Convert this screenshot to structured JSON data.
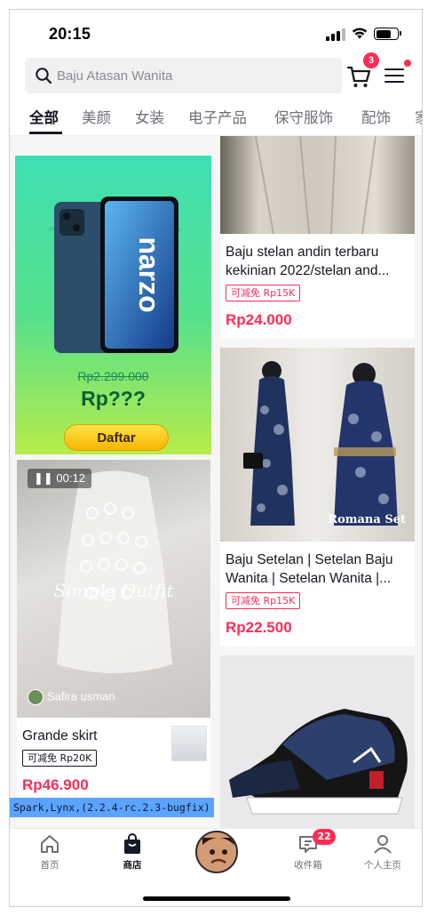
{
  "status_bar": {
    "time": "20:15"
  },
  "header": {
    "search_placeholder": "Baju Atasan Wanita",
    "cart_count": "3",
    "icons": {
      "search": "search-icon",
      "cart": "cart-icon",
      "menu": "menu-icon"
    }
  },
  "tabs": [
    {
      "label": "全部",
      "active": true
    },
    {
      "label": "美颜"
    },
    {
      "label": "女装"
    },
    {
      "label": "电子产品"
    },
    {
      "label": "保守服饰"
    },
    {
      "label": "配饰"
    },
    {
      "label": "家"
    }
  ],
  "feed": {
    "ad": {
      "brand": "narzo",
      "old_price": "Rp2.299.000",
      "price": "Rp???",
      "button": "Daftar"
    },
    "video": {
      "duration": "00:12",
      "overlay_text": "Simple Outfit",
      "author": "Safira usman",
      "title": "Grande skirt",
      "coupon": "可减免 Rp20K",
      "price": "Rp46.900"
    },
    "products": [
      {
        "title_line1": "Baju stelan andin terbaru",
        "title_line2": "kekinian 2022/stelan and...",
        "coupon": "可减免 Rp15K",
        "price": "Rp24.000"
      },
      {
        "title_line1": "Baju Setelan | Setelan Baju",
        "title_line2": "Wanita | Setelan Wanita |...",
        "coupon": "可减免 Rp15K",
        "price": "Rp22.500",
        "image_caption": "Romana Set"
      },
      {}
    ]
  },
  "debug_label": "Spark,Lynx,(2.2.4-rc.2.3-bugfix)",
  "bottom_nav": {
    "items": [
      {
        "label": "首页",
        "icon": "home-icon"
      },
      {
        "label": "商店",
        "icon": "shop-bag-icon",
        "active": true
      },
      {
        "label": "",
        "icon": "profile-avatar"
      },
      {
        "label": "收件箱",
        "icon": "inbox-icon",
        "badge": "22"
      },
      {
        "label": "个人主页",
        "icon": "person-icon"
      }
    ]
  },
  "colors": {
    "accent": "#fe2c55",
    "text": "#161823",
    "muted": "#6e6f76"
  }
}
